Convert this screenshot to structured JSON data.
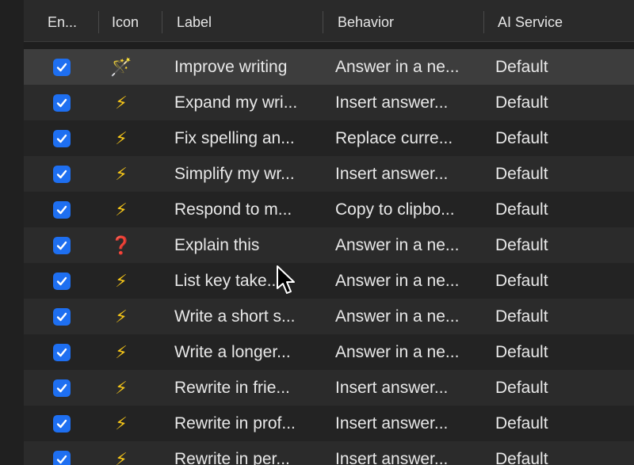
{
  "columns": {
    "enabled": "En...",
    "icon": "Icon",
    "label": "Label",
    "behavior": "Behavior",
    "service": "AI Service"
  },
  "rows": [
    {
      "icon": "magic-wand-icon",
      "glyph": "🪄",
      "label": "Improve writing",
      "behavior": "Answer in a ne...",
      "service": "Default",
      "checked": true
    },
    {
      "icon": "lightning-icon",
      "glyph": "⚡",
      "label": "Expand my wri...",
      "behavior": "Insert answer...",
      "service": "Default",
      "checked": true
    },
    {
      "icon": "lightning-icon",
      "glyph": "⚡",
      "label": "Fix spelling an...",
      "behavior": "Replace curre...",
      "service": "Default",
      "checked": true
    },
    {
      "icon": "lightning-icon",
      "glyph": "⚡",
      "label": "Simplify my wr...",
      "behavior": "Insert answer...",
      "service": "Default",
      "checked": true
    },
    {
      "icon": "lightning-icon",
      "glyph": "⚡",
      "label": "Respond to m...",
      "behavior": "Copy to clipbo...",
      "service": "Default",
      "checked": true
    },
    {
      "icon": "question-mark-icon",
      "glyph": "❓",
      "label": "Explain this",
      "behavior": "Answer in a ne...",
      "service": "Default",
      "checked": true
    },
    {
      "icon": "lightning-icon",
      "glyph": "⚡",
      "label": "List key take...",
      "behavior": "Answer in a ne...",
      "service": "Default",
      "checked": true
    },
    {
      "icon": "lightning-icon",
      "glyph": "⚡",
      "label": "Write a short s...",
      "behavior": "Answer in a ne...",
      "service": "Default",
      "checked": true
    },
    {
      "icon": "lightning-icon",
      "glyph": "⚡",
      "label": "Write a longer...",
      "behavior": "Answer in a ne...",
      "service": "Default",
      "checked": true
    },
    {
      "icon": "lightning-icon",
      "glyph": "⚡",
      "label": "Rewrite in frie...",
      "behavior": "Insert answer...",
      "service": "Default",
      "checked": true
    },
    {
      "icon": "lightning-icon",
      "glyph": "⚡",
      "label": "Rewrite in prof...",
      "behavior": "Insert answer...",
      "service": "Default",
      "checked": true
    },
    {
      "icon": "lightning-icon",
      "glyph": "⚡",
      "label": "Rewrite in per...",
      "behavior": "Insert answer...",
      "service": "Default",
      "checked": true
    }
  ],
  "colors": {
    "accent": "#1e6ff1",
    "bolt": "#f5c518",
    "question": "#d0161c"
  }
}
